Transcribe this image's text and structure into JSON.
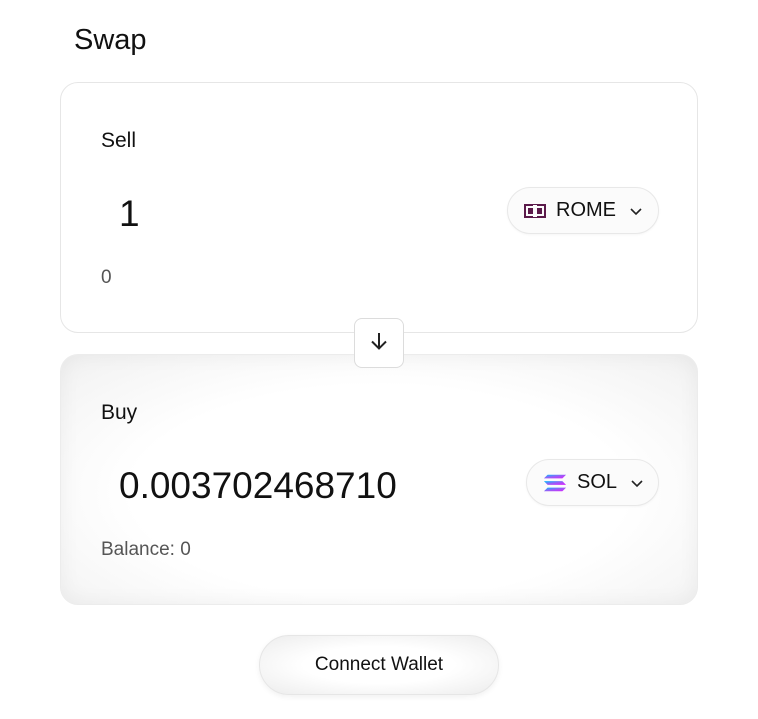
{
  "page": {
    "title": "Swap"
  },
  "sell": {
    "label": "Sell",
    "amount": "1",
    "sub_value": "0",
    "token": {
      "symbol": "ROME",
      "icon": "rome-logo-icon",
      "color": "#5b1a4a"
    }
  },
  "buy": {
    "label": "Buy",
    "amount": "0.003702468710",
    "balance": "Balance: 0",
    "token": {
      "symbol": "SOL",
      "icon": "solana-logo-icon"
    }
  },
  "swap_direction": {
    "icon": "arrow-down-icon"
  },
  "connect_wallet": {
    "label": "Connect Wallet"
  }
}
